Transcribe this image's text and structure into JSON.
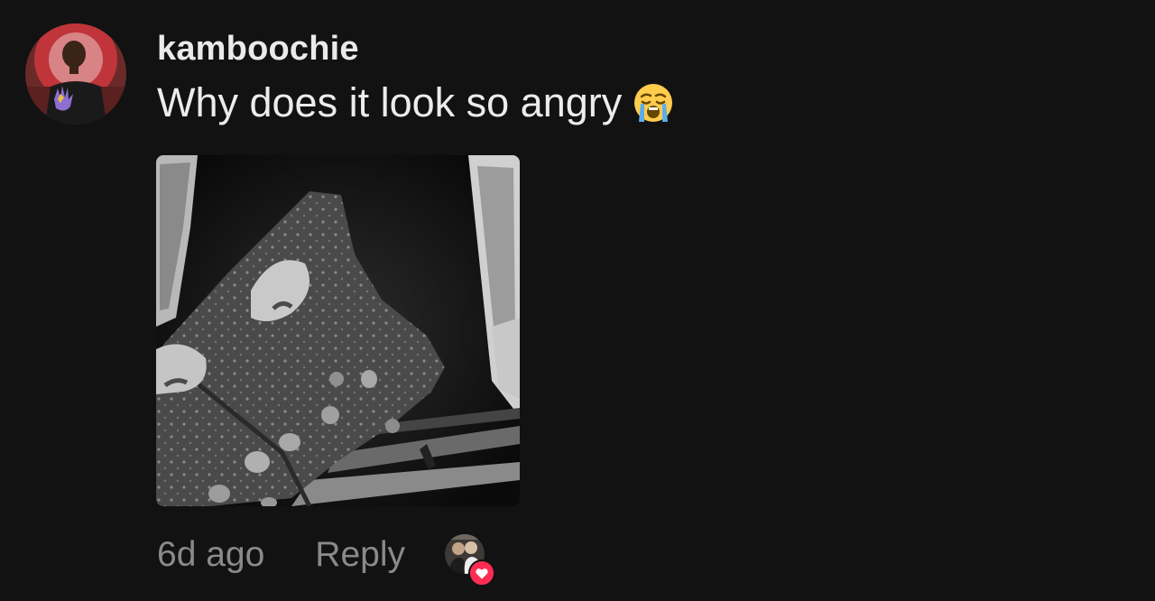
{
  "comment": {
    "username": "kamboochie",
    "text": "Why does it look so angry",
    "emoji": "loudly-crying-face-icon",
    "timestamp": "6d ago",
    "reply_label": "Reply",
    "creator_liked": true
  },
  "colors": {
    "background": "#121212",
    "text_primary": "#ececec",
    "text_secondary": "#8a8a8a",
    "like_badge": "#fe2c55"
  }
}
